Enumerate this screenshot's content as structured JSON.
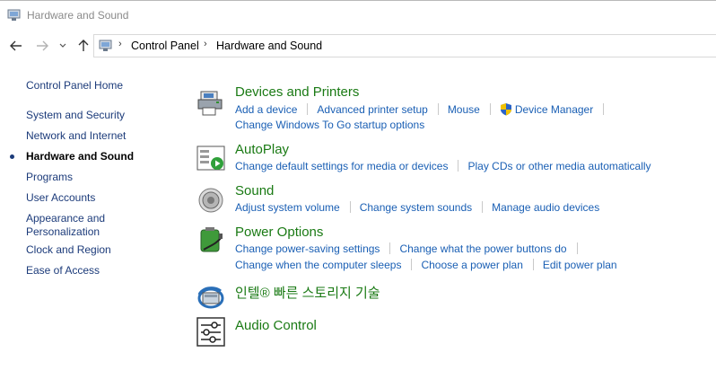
{
  "window": {
    "title": "Hardware and Sound"
  },
  "breadcrumb": [
    "Control Panel",
    "Hardware and Sound"
  ],
  "sidebar": {
    "items": [
      {
        "label": "Control Panel Home"
      },
      {
        "label": "System and Security"
      },
      {
        "label": "Network and Internet"
      },
      {
        "label": "Hardware and Sound",
        "current": true
      },
      {
        "label": "Programs"
      },
      {
        "label": "User Accounts"
      },
      {
        "label": "Appearance and Personalization"
      },
      {
        "label": "Clock and Region"
      },
      {
        "label": "Ease of Access"
      }
    ]
  },
  "categories": [
    {
      "title": "Devices and Printers",
      "icon": "printer-icon",
      "rows": [
        [
          "Add a device",
          "Advanced printer setup",
          "Mouse",
          "Device Manager"
        ],
        [
          "Change Windows To Go startup options"
        ]
      ]
    },
    {
      "title": "AutoPlay",
      "icon": "autoplay-icon",
      "rows": [
        [
          "Change default settings for media or devices",
          "Play CDs or other media automatically"
        ]
      ]
    },
    {
      "title": "Sound",
      "icon": "speaker-icon",
      "rows": [
        [
          "Adjust system volume",
          "Change system sounds",
          "Manage audio devices"
        ]
      ]
    },
    {
      "title": "Power Options",
      "icon": "battery-icon",
      "rows": [
        [
          "Change power-saving settings",
          "Change what the power buttons do"
        ],
        [
          "Change when the computer sleeps",
          "Choose a power plan",
          "Edit power plan"
        ]
      ]
    },
    {
      "title": "인텔® 빠른 스토리지 기술",
      "icon": "intel-storage-icon",
      "rows": []
    },
    {
      "title": "Audio Control",
      "icon": "sliders-icon",
      "rows": []
    }
  ],
  "colors": {
    "link": "#1a5fb4",
    "category_title": "#1a7a14",
    "sidebar_link": "#1c3b7a"
  }
}
